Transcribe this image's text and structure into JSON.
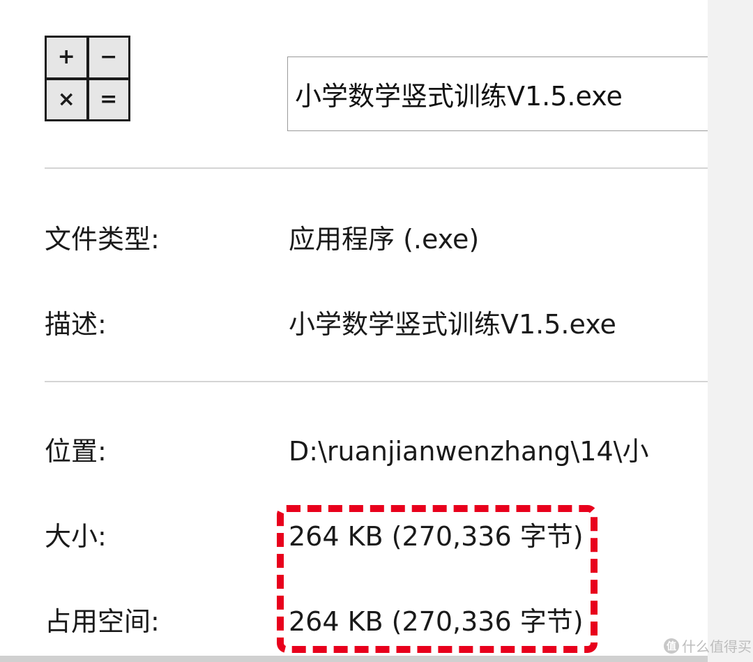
{
  "file": {
    "name": "小学数学竖式训练V1.5.exe",
    "icon": {
      "name": "calculator-icon",
      "symbols": [
        "+",
        "−",
        "×",
        "="
      ]
    }
  },
  "properties": {
    "file_type": {
      "label": "文件类型:",
      "value": "应用程序 (.exe)"
    },
    "description": {
      "label": "描述:",
      "value": "小学数学竖式训练V1.5.exe"
    },
    "location": {
      "label": "位置:",
      "value": "D:\\ruanjianwenzhang\\14\\小"
    },
    "size": {
      "label": "大小:",
      "value": "264 KB (270,336 字节)"
    },
    "size_on_disk": {
      "label": "占用空间:",
      "value": "264 KB (270,336 字节)"
    }
  },
  "annotation": {
    "color": "#e8001c",
    "style": "dashed"
  },
  "watermark": {
    "text": "什么值得买",
    "logo": "值"
  }
}
